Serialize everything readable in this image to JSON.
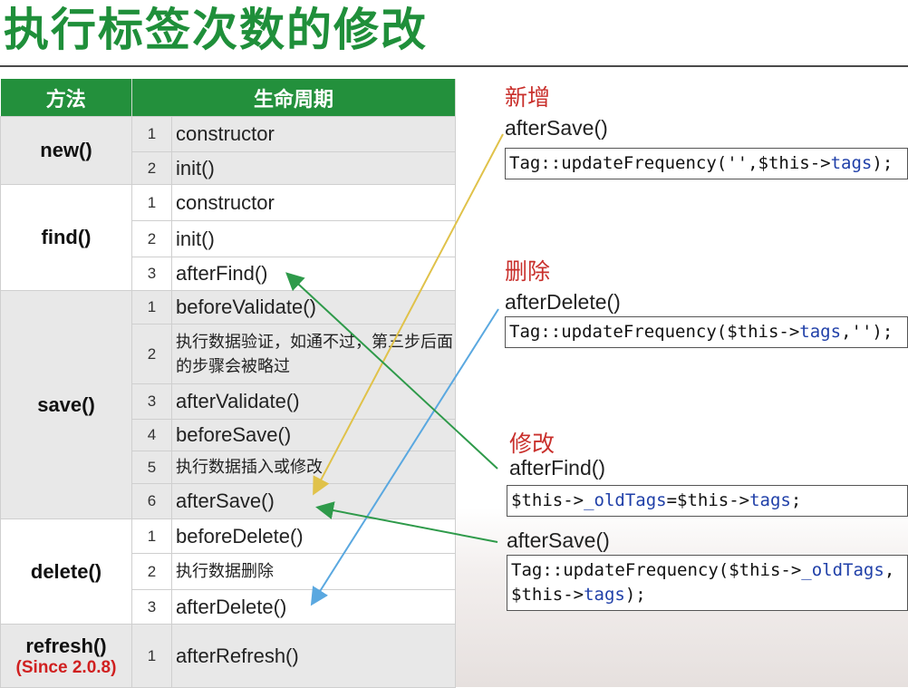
{
  "title": "执行标签次数的修改",
  "table": {
    "headers": [
      "方法",
      "生命周期"
    ],
    "groups": [
      {
        "method": "new()",
        "steps": [
          {
            "n": "1",
            "text": "constructor"
          },
          {
            "n": "2",
            "text": "init()"
          }
        ]
      },
      {
        "method": "find()",
        "steps": [
          {
            "n": "1",
            "text": "constructor"
          },
          {
            "n": "2",
            "text": "init()"
          },
          {
            "n": "3",
            "text": "afterFind()"
          }
        ]
      },
      {
        "method": "save()",
        "steps": [
          {
            "n": "1",
            "text": "beforeValidate()"
          },
          {
            "n": "2",
            "text": "执行数据验证，如通不过，第三步后面的步骤会被略过"
          },
          {
            "n": "3",
            "text": "afterValidate()"
          },
          {
            "n": "4",
            "text": "beforeSave()"
          },
          {
            "n": "5",
            "text": "执行数据插入或修改"
          },
          {
            "n": "6",
            "text": "afterSave()"
          }
        ]
      },
      {
        "method": "delete()",
        "steps": [
          {
            "n": "1",
            "text": "beforeDelete()"
          },
          {
            "n": "2",
            "text": "执行数据删除"
          },
          {
            "n": "3",
            "text": "afterDelete()"
          }
        ]
      },
      {
        "method": "refresh()",
        "note": "(Since 2.0.8)",
        "steps": [
          {
            "n": "1",
            "text": "afterRefresh()"
          }
        ]
      }
    ]
  },
  "right": {
    "add": {
      "heading": "新增",
      "method": "afterSave()",
      "code": [
        "Tag::updateFrequency('',$this->",
        "tags",
        ");"
      ]
    },
    "delete": {
      "heading": "删除",
      "method": "afterDelete()",
      "code": [
        "Tag::updateFrequency($this->",
        "tags",
        ",'');"
      ]
    },
    "modify": {
      "heading": "修改",
      "find_method": "afterFind()",
      "find_code": [
        "$this->",
        "_oldTags",
        "=$this->",
        "tags",
        ";"
      ],
      "save_method": "afterSave()",
      "save_code_line1": [
        "Tag::updateFrequency($this->",
        "_oldTags",
        ","
      ],
      "save_code_line2": [
        "$this->",
        "tags",
        ");"
      ]
    }
  },
  "colors": {
    "title_green": "#1f8f3a",
    "header_green": "#23903c",
    "heading_red": "#c9302c",
    "arrow_yellow": "#e0c24a",
    "arrow_blue": "#5aa8e0",
    "arrow_green": "#2e9a4a",
    "code_var_blue": "#1f3fa8"
  }
}
